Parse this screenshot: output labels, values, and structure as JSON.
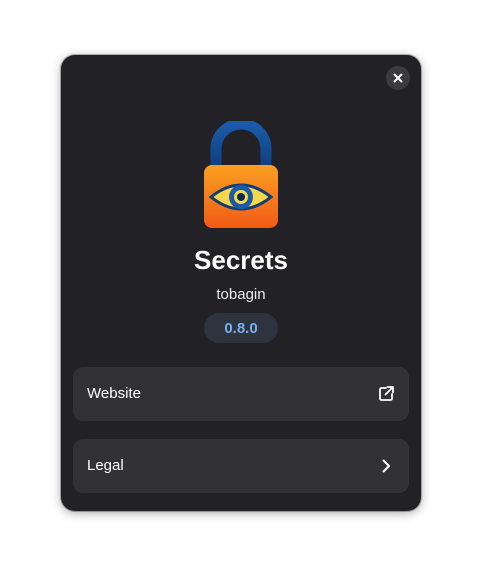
{
  "app": {
    "name": "Secrets",
    "developer": "tobagin",
    "version": "0.8.0",
    "icon": "padlock-eye-icon"
  },
  "rows": {
    "website": {
      "label": "Website",
      "icon": "external-link-icon"
    },
    "legal": {
      "label": "Legal",
      "icon": "chevron-right-icon"
    }
  },
  "dialog": {
    "close_icon": "close-icon"
  },
  "colors": {
    "dialog_background": "#222226",
    "row_background": "#323236",
    "accent": "#78aeed",
    "version_badge_background": "#2d3440"
  }
}
